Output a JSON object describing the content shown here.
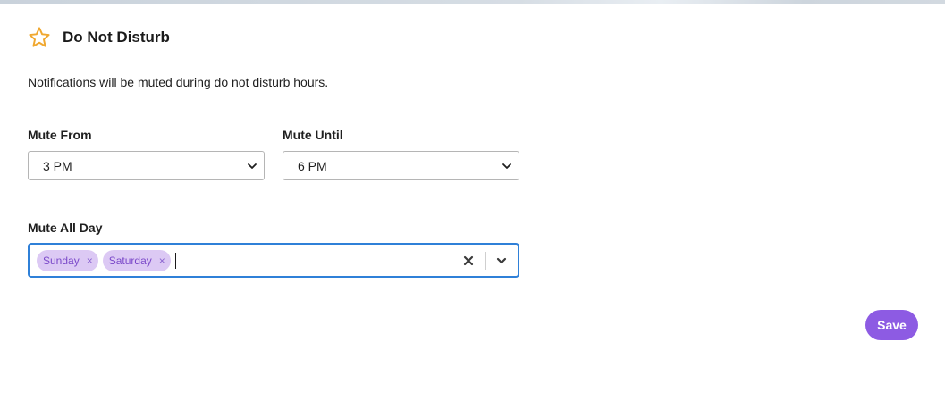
{
  "header": {
    "title": "Do Not Disturb",
    "icon": "star-icon",
    "icon_color": "#f0a830"
  },
  "description": "Notifications will be muted during do not disturb hours.",
  "mute_from": {
    "label": "Mute From",
    "value": "3 PM"
  },
  "mute_until": {
    "label": "Mute Until",
    "value": "6 PM"
  },
  "mute_all_day": {
    "label": "Mute All Day",
    "tags": [
      "Sunday",
      "Saturday"
    ],
    "tag_remove_glyph": "×"
  },
  "save_button": {
    "label": "Save",
    "color": "#8d5be3"
  },
  "colors": {
    "focus_border": "#2f80d8",
    "tag_bg": "#dcc9f4",
    "tag_text": "#7a48c9"
  }
}
